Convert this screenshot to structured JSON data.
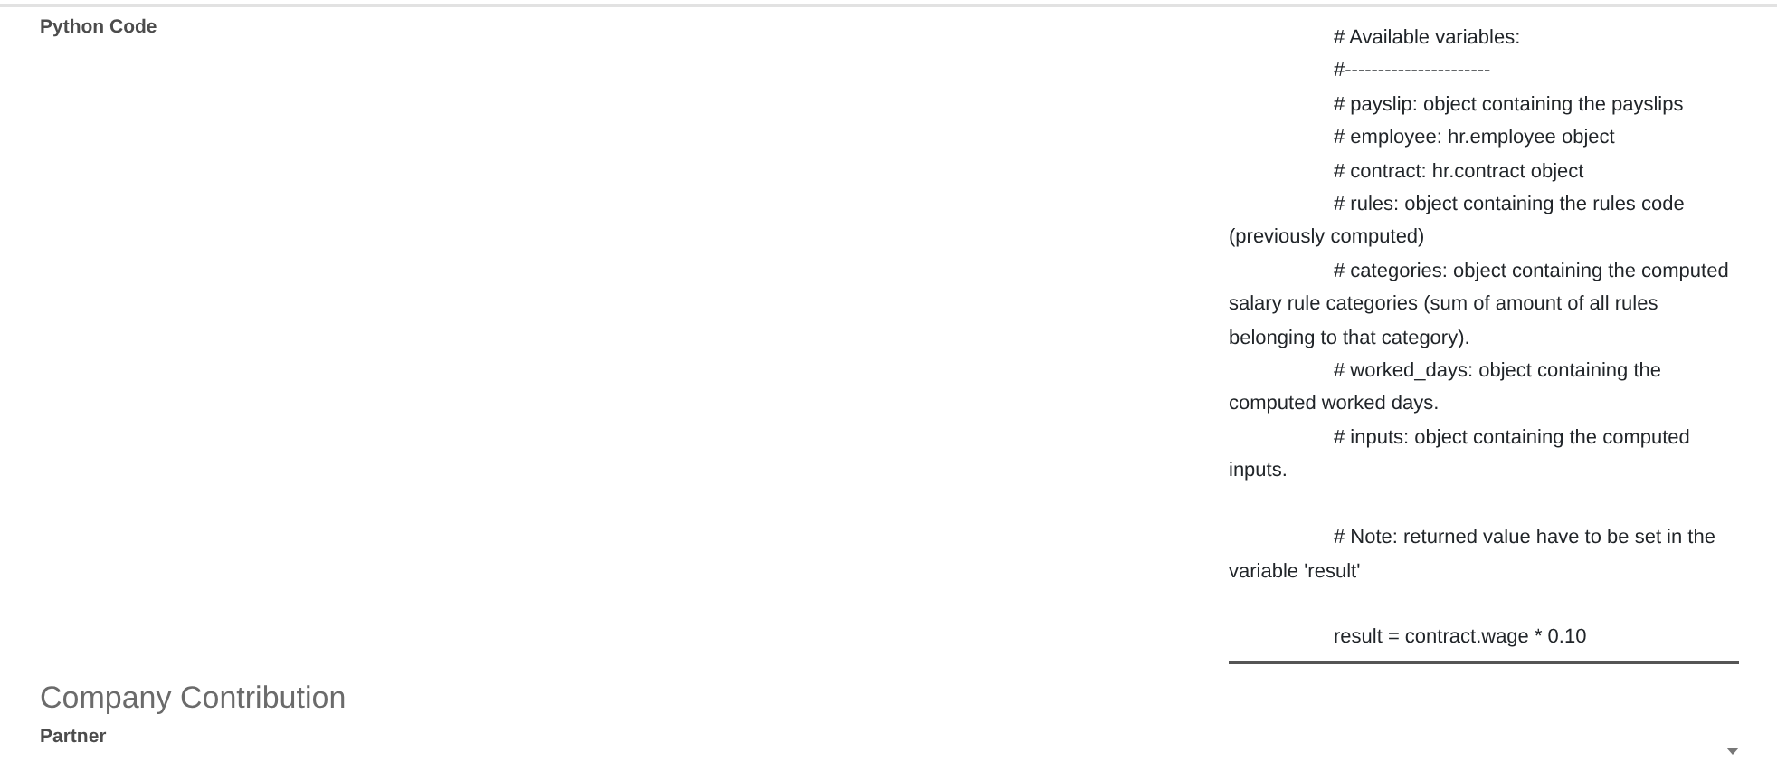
{
  "python_code": {
    "label": "Python Code",
    "value": "\t# Available variables:\n\t#----------------------\n\t# payslip: object containing the payslips\n\t# employee: hr.employee object\n\t# contract: hr.contract object\n\t# rules: object containing the rules code (previously computed)\n\t# categories: object containing the computed salary rule categories (sum of amount of all rules belonging to that category).\n\t# worked_days: object containing the computed worked days.\n\t# inputs: object containing the computed inputs.\n\n\t# Note: returned value have to be set in the variable 'result'\n\n\tresult = contract.wage * 0.10"
  },
  "company_contribution": {
    "title": "Company Contribution",
    "partner": {
      "label": "Partner"
    }
  }
}
